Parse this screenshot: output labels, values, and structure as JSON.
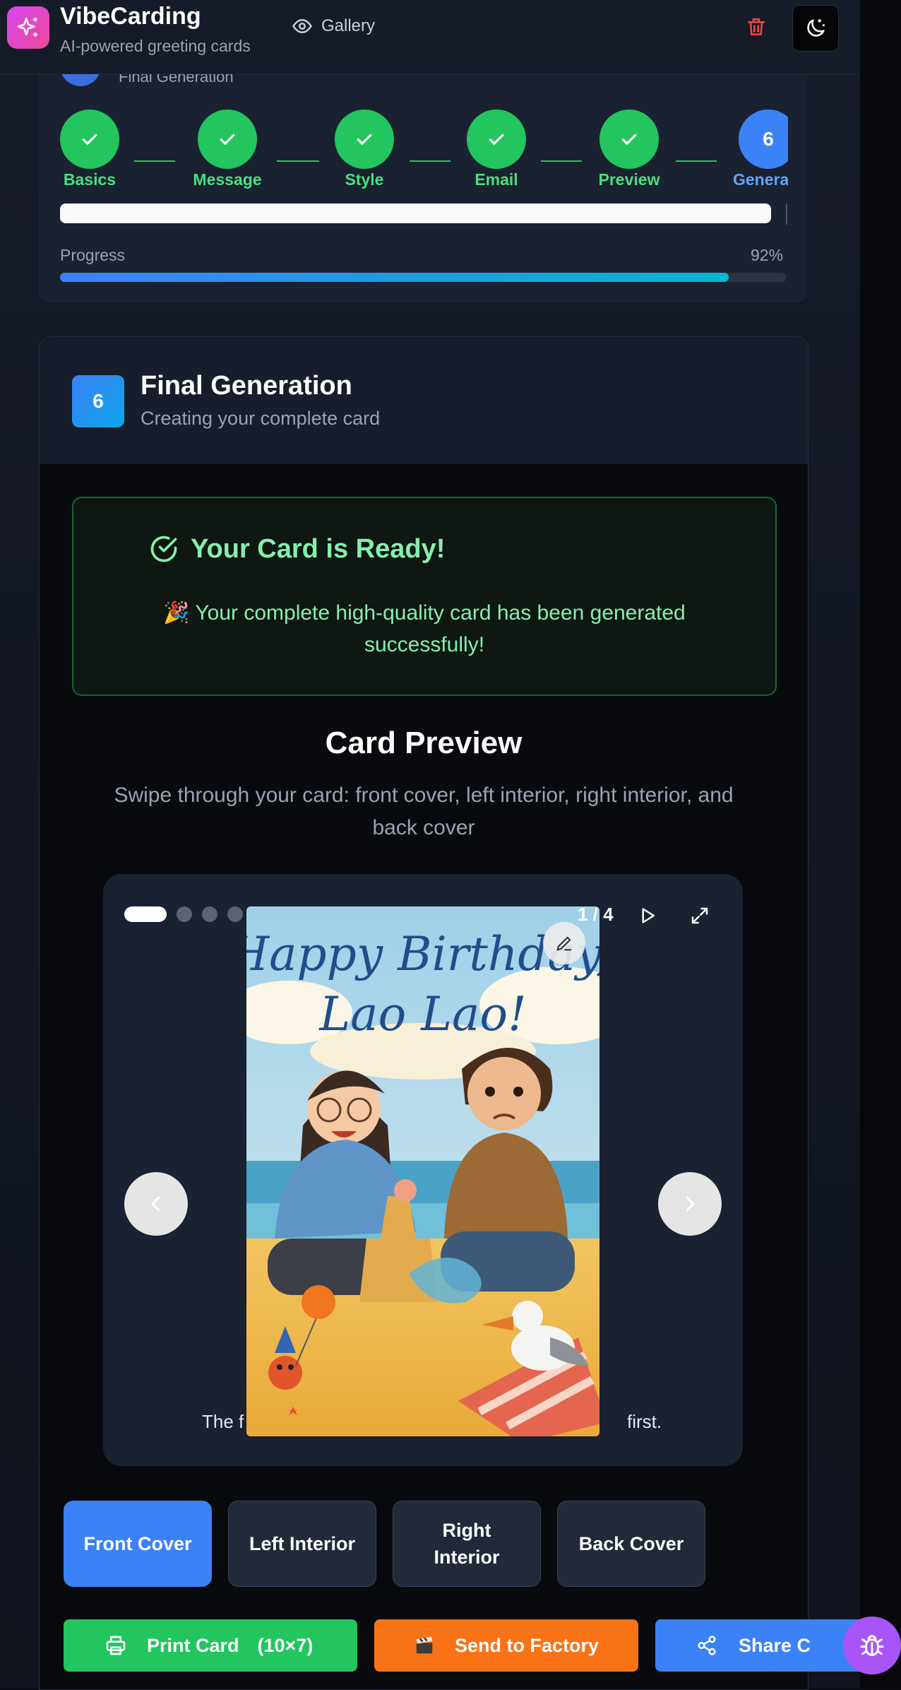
{
  "app": {
    "name": "VibeCarding",
    "tagline": "AI-powered greeting cards",
    "gallery_label": "Gallery"
  },
  "stepper": {
    "ghost_label": "Final Generation",
    "steps": [
      {
        "label": "Basics",
        "state": "done"
      },
      {
        "label": "Message",
        "state": "done"
      },
      {
        "label": "Style",
        "state": "done"
      },
      {
        "label": "Email",
        "state": "done"
      },
      {
        "label": "Preview",
        "state": "done"
      },
      {
        "label": "Generation",
        "state": "current",
        "number": "6"
      }
    ],
    "progress_label": "Progress",
    "progress_value": "92%",
    "progress_fraction": 0.92
  },
  "generation": {
    "step_number": "6",
    "title": "Final Generation",
    "subtitle": "Creating your complete card",
    "ready_title": "Your Card is Ready!",
    "ready_message": "🎉 Your complete high-quality card has been generated successfully!"
  },
  "preview": {
    "title": "Card Preview",
    "subtitle": "Swipe through your card: front cover, left interior, right interior, and back cover",
    "counter": "1 / 4",
    "active_slide": 1,
    "slide_count": 4,
    "card_text": "Happy Birthday, Lao Lao!",
    "caption_left": "The f",
    "caption_right": "first."
  },
  "tabs": [
    "Front Cover",
    "Left Interior",
    "Right Interior",
    "Back Cover"
  ],
  "actions": {
    "print_label": "Print Card",
    "print_size": "(10×7)",
    "factory_label": "Send to Factory",
    "share_label": "Share C"
  },
  "colors": {
    "success": "#22c55e",
    "primary": "#3b82f6",
    "factory": "#f97316",
    "brand": "#d946ef",
    "debug": "#a855f7"
  },
  "icons": [
    "sparkles-icon",
    "eye-icon",
    "trash-icon",
    "moon-stars-icon",
    "check-icon",
    "check-circle-icon",
    "play-icon",
    "expand-icon",
    "pencil-icon",
    "chevron-left-icon",
    "chevron-right-icon",
    "printer-icon",
    "clapperboard-icon",
    "share-icon",
    "bug-icon"
  ]
}
